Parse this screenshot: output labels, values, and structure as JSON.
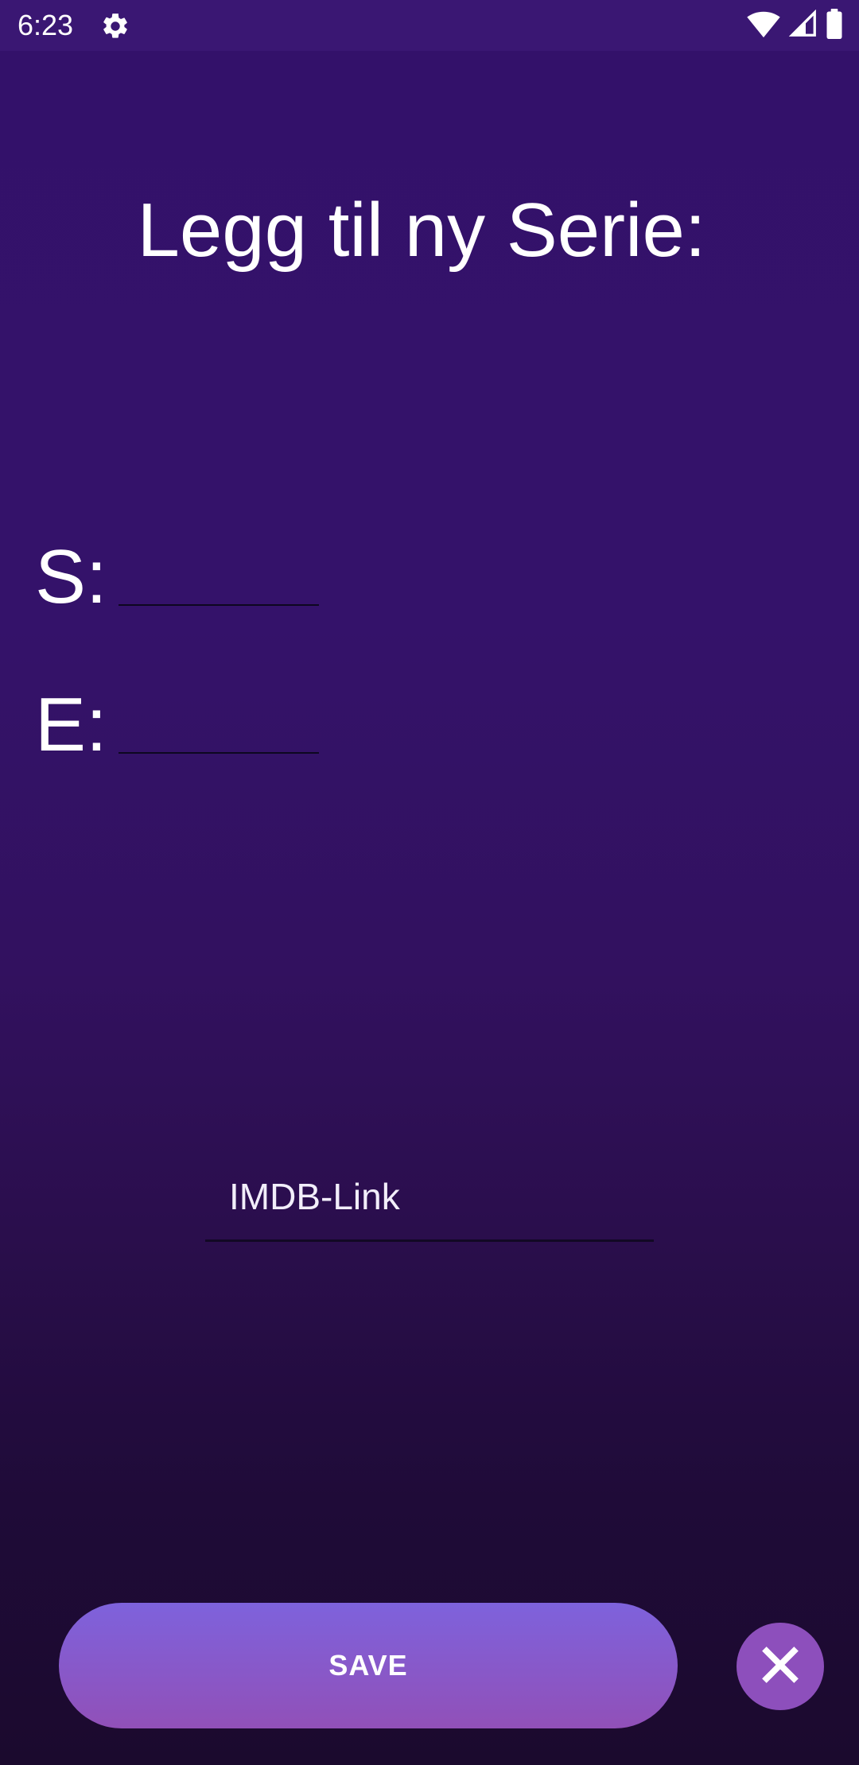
{
  "status_bar": {
    "time": "6:23",
    "icons": [
      "settings-gear-icon",
      "wifi-icon",
      "signal-icon",
      "battery-icon"
    ]
  },
  "screen": {
    "title": "Legg til ny Serie:",
    "season_label": "S:",
    "episode_label": "E:",
    "imdb_placeholder": "IMDB-Link",
    "save_label": "SAVE",
    "close_icon": "close-icon"
  },
  "colors": {
    "background_top": "#33116a",
    "background_bottom": "#1b0a2e",
    "status_bar": "#3a1773",
    "save_button_top": "#7e62dc",
    "save_button_bottom": "#9150b8",
    "close_button": "#8d4fbc",
    "text": "#ffffff"
  }
}
